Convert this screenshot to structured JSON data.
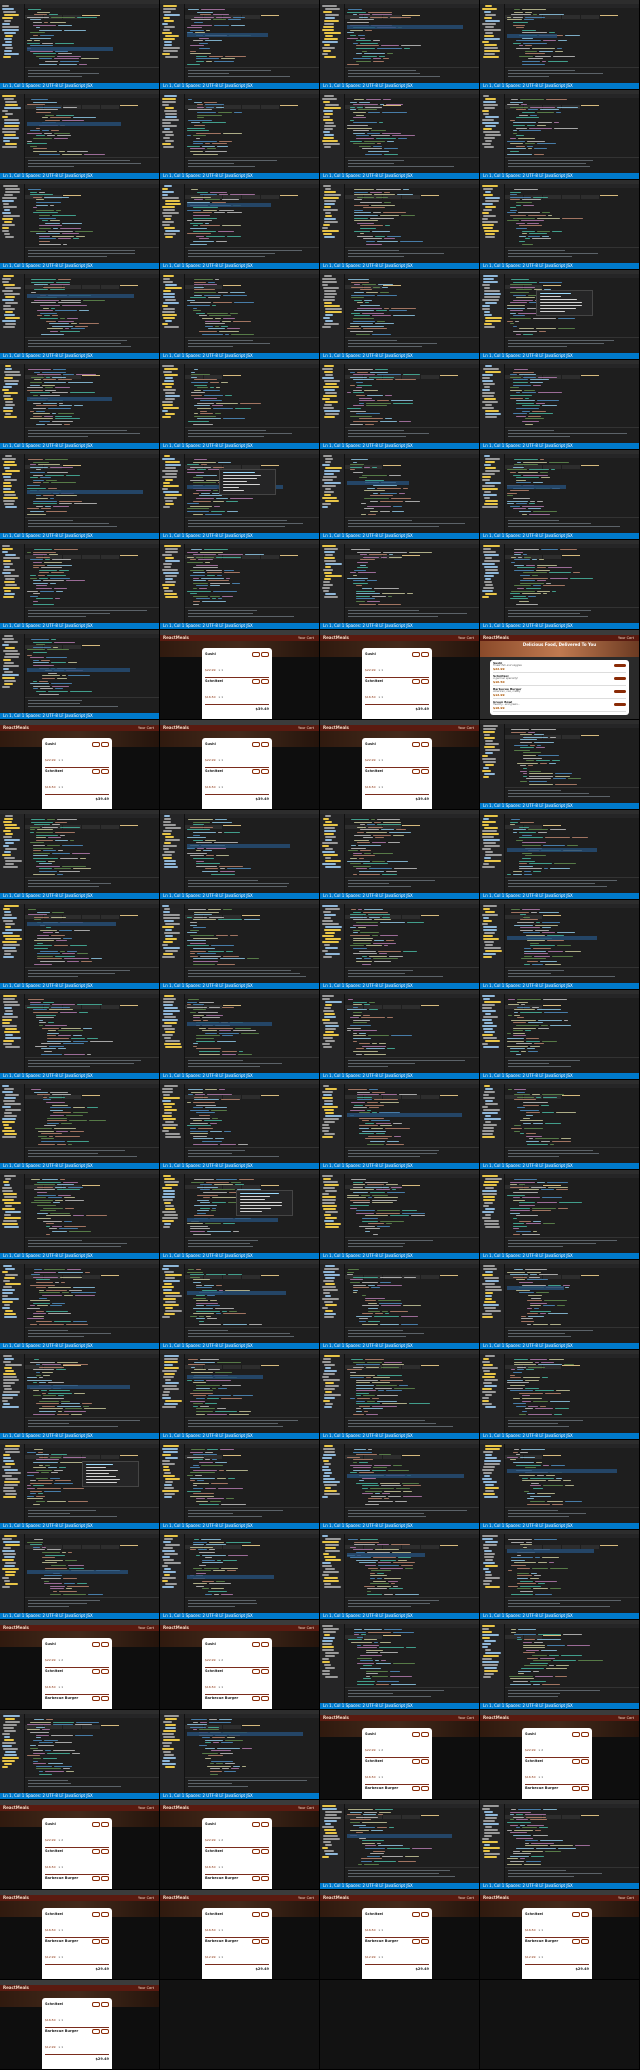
{
  "screen": {
    "columns": 4,
    "rows": 23
  },
  "ide": {
    "status_text": "Ln 1, Col 1   Spaces: 2   UTF-8   LF   JavaScript JSX",
    "accent_color": "#007acc"
  },
  "app": {
    "brand": "ReactMeals",
    "cart_label": "Your Cart",
    "hero_title": "Delicious Food, Delivered To You",
    "total_label": "Total Amount",
    "close_label": "Close",
    "order_label": "Order",
    "accent_color": "#8a2b06"
  },
  "cart_views": {
    "a": {
      "items": [
        {
          "name": "Sushi",
          "price": "$22.99",
          "qty": "x 1"
        },
        {
          "name": "Schnitzel",
          "price": "$16.50",
          "qty": "x 1"
        }
      ],
      "total": "$39.49"
    },
    "b": {
      "items": [
        {
          "name": "Sushi",
          "price": "$22.99",
          "qty": "x 2"
        },
        {
          "name": "Schnitzel",
          "price": "$16.50",
          "qty": "x 1"
        },
        {
          "name": "Barbecue Burger",
          "price": "$12.99",
          "qty": "x 1"
        },
        {
          "name": "Green Bowl",
          "price": "$18.99",
          "qty": "x 1"
        }
      ],
      "total": "$94.46"
    },
    "c": {
      "items": [
        {
          "name": "Schnitzel",
          "price": "$16.50",
          "qty": "x 1"
        },
        {
          "name": "Barbecue Burger",
          "price": "$12.99",
          "qty": "x 1"
        }
      ],
      "total": "$29.49"
    }
  },
  "menu": [
    {
      "name": "Sushi",
      "desc": "Finest fish and veggies",
      "price": "$22.99"
    },
    {
      "name": "Schnitzel",
      "desc": "A german specialty!",
      "price": "$16.50"
    },
    {
      "name": "Barbecue Burger",
      "desc": "American, raw, meaty",
      "price": "$12.99"
    },
    {
      "name": "Green Bowl",
      "desc": "Healthy...and green...",
      "price": "$18.99"
    }
  ],
  "tiles": [
    "ide",
    "ide",
    "ide",
    "ide",
    "ide",
    "ide",
    "ide",
    "ide",
    "ide",
    "ide",
    "ide",
    "ide",
    "ide",
    "ide",
    "ide",
    "ide-popup",
    "ide",
    "ide",
    "ide",
    "ide",
    "ide",
    "ide-popup",
    "ide",
    "ide",
    "ide",
    "ide",
    "ide",
    "ide",
    "ide",
    "cart-a",
    "cart-a",
    "menu",
    "cart-a",
    "cart-a",
    "cart-a",
    "ide",
    "ide",
    "ide",
    "ide",
    "ide",
    "ide",
    "ide",
    "ide",
    "ide",
    "ide",
    "ide",
    "ide",
    "ide",
    "ide",
    "ide",
    "ide",
    "ide",
    "ide",
    "ide-popup",
    "ide",
    "ide",
    "ide",
    "ide",
    "ide",
    "ide",
    "ide",
    "ide",
    "ide",
    "ide",
    "ide-popup",
    "ide",
    "ide",
    "ide",
    "ide",
    "ide",
    "ide",
    "ide",
    "cart-b",
    "cart-b",
    "ide",
    "ide",
    "ide",
    "ide",
    "cart-b",
    "cart-b",
    "cart-b",
    "cart-b",
    "ide",
    "ide",
    "cart-c",
    "cart-c",
    "cart-c",
    "cart-c",
    "cart-c",
    "empty",
    "empty",
    "empty"
  ]
}
